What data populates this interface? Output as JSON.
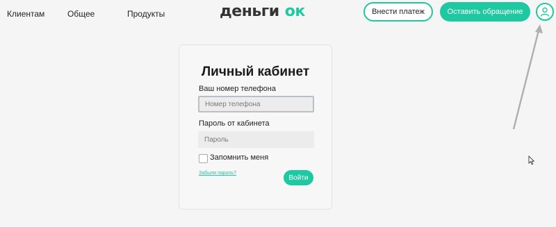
{
  "nav": {
    "items": [
      {
        "label": "Клиентам"
      },
      {
        "label": "Общее"
      },
      {
        "label": "Продукты"
      }
    ]
  },
  "logo": {
    "text": "деньги",
    "accent": "ок"
  },
  "header": {
    "pay_button": "Внести платеж",
    "request_button": "Оставить обращение",
    "profile_icon": "user-icon"
  },
  "login": {
    "title": "Личный кабинет",
    "phone_label": "Ваш номер телефона",
    "phone_placeholder": "Номер телефона",
    "password_label": "Пароль от кабинета",
    "password_placeholder": "Пароль",
    "remember_label": "Запомнить меня",
    "remember_checked": false,
    "forgot_link": "Забыли пароль?",
    "submit_button": "Войти"
  },
  "colors": {
    "accent": "#1ec8a0",
    "background": "#f5f5f5"
  }
}
